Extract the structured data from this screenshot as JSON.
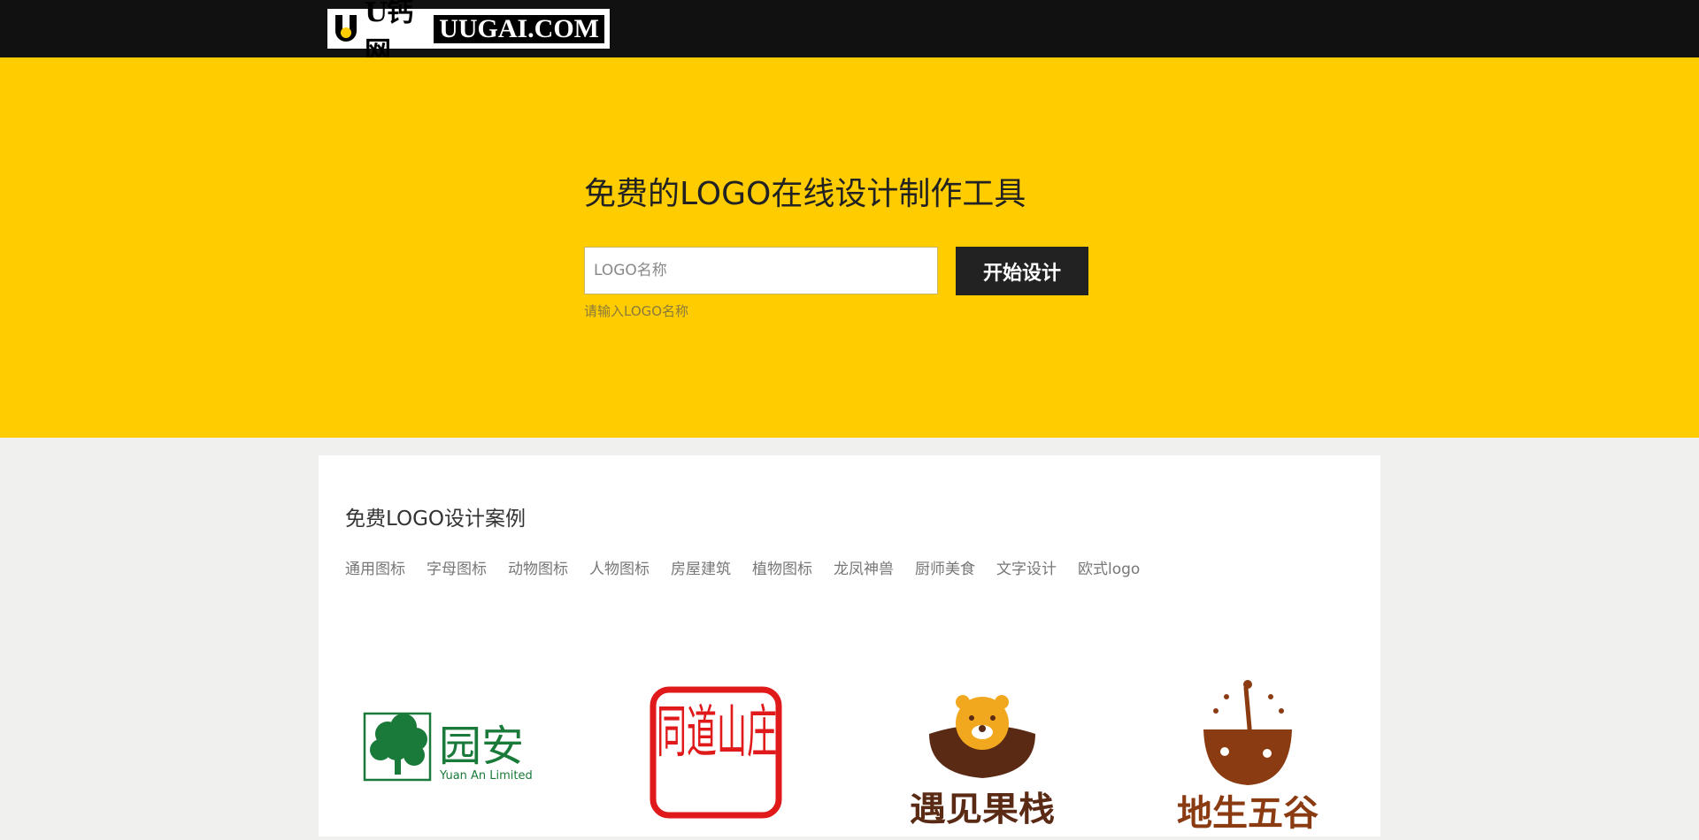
{
  "header": {
    "brand_cn": "U钙网",
    "brand_en": "UUGAI.COM"
  },
  "hero": {
    "title": "免费的LOGO在线设计制作工具",
    "input_placeholder": "LOGO名称",
    "button_label": "开始设计",
    "hint": "请输入LOGO名称"
  },
  "cases": {
    "title": "免费LOGO设计案例",
    "categories": [
      "通用图标",
      "字母图标",
      "动物图标",
      "人物图标",
      "房屋建筑",
      "植物图标",
      "龙凤神兽",
      "厨师美食",
      "文字设计",
      "欧式logo"
    ],
    "items": [
      {
        "name_cn": "园安",
        "name_en": "Yuan An Limited",
        "color": "#1a7a3a"
      },
      {
        "text": "同道山庄",
        "color": "#e01a1a"
      },
      {
        "text": "遇见果栈",
        "color": "#5a2a14",
        "accent": "#f2a81e"
      },
      {
        "text": "地生五谷",
        "color": "#8a3b12"
      }
    ]
  },
  "colors": {
    "topbar": "#111111",
    "hero": "#ffcc00",
    "button": "#222222"
  }
}
